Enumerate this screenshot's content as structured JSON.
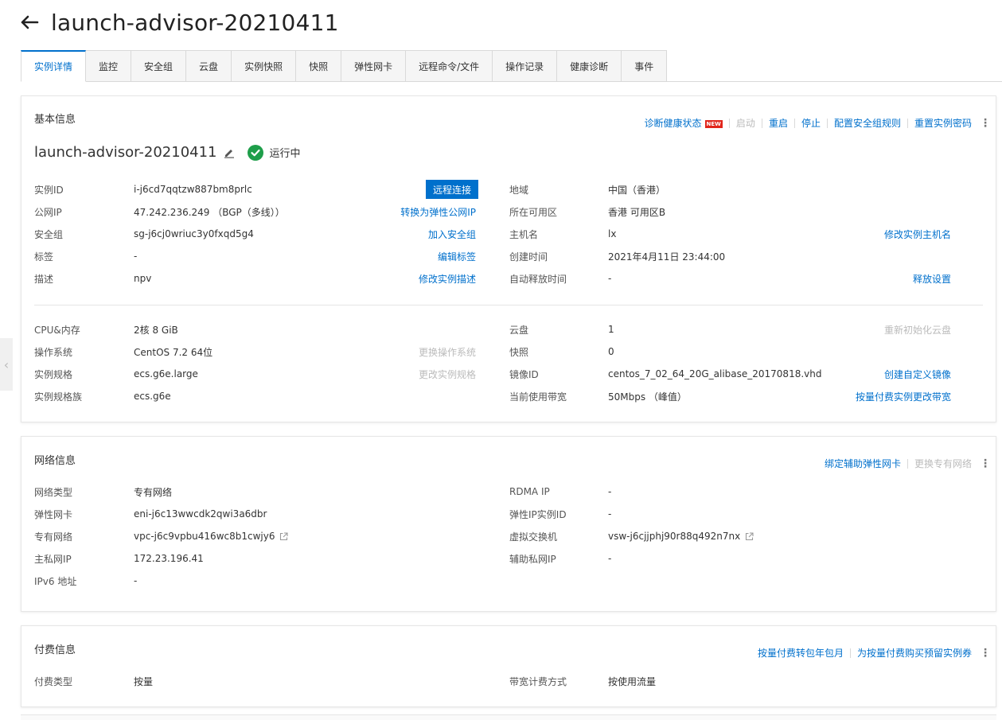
{
  "page": {
    "title": "launch-advisor-20210411"
  },
  "tabs": [
    {
      "label": "实例详情"
    },
    {
      "label": "监控"
    },
    {
      "label": "安全组"
    },
    {
      "label": "云盘"
    },
    {
      "label": "实例快照"
    },
    {
      "label": "快照"
    },
    {
      "label": "弹性网卡"
    },
    {
      "label": "远程命令/文件"
    },
    {
      "label": "操作记录"
    },
    {
      "label": "健康诊断"
    },
    {
      "label": "事件"
    }
  ],
  "basic": {
    "title": "基本信息",
    "actions": {
      "diagnose": "诊断健康状态",
      "new_badge": "NEW",
      "start": "启动",
      "restart": "重启",
      "stop": "停止",
      "sg_rules": "配置安全组规则",
      "reset_pwd": "重置实例密码"
    },
    "instance_name": "launch-advisor-20210411",
    "status": "运行中",
    "remote_connect": "远程连接",
    "left": [
      {
        "label": "实例ID",
        "value": "i-j6cd7qqtzw887bm8prlc",
        "action": ""
      },
      {
        "label": "公网IP",
        "value": "47.242.236.249 （BGP（多线））",
        "action": "转换为弹性公网IP"
      },
      {
        "label": "安全组",
        "value": "sg-j6cj0wriuc3y0fxqd5g4",
        "action": "加入安全组"
      },
      {
        "label": "标签",
        "value": "-",
        "action": "编辑标签"
      },
      {
        "label": "描述",
        "value": "npv",
        "action": "修改实例描述"
      }
    ],
    "right": [
      {
        "label": "地域",
        "value": "中国（香港）",
        "action": ""
      },
      {
        "label": "所在可用区",
        "value": "香港 可用区B",
        "action": ""
      },
      {
        "label": "主机名",
        "value": "lx",
        "action": "修改实例主机名"
      },
      {
        "label": "创建时间",
        "value": "2021年4月11日 23:44:00",
        "action": ""
      },
      {
        "label": "自动释放时间",
        "value": "-",
        "action": "释放设置"
      }
    ],
    "left2": [
      {
        "label": "CPU&内存",
        "value": "2核 8 GiB",
        "action": ""
      },
      {
        "label": "操作系统",
        "value": "CentOS 7.2 64位",
        "action": "更换操作系统"
      },
      {
        "label": "实例规格",
        "value": "ecs.g6e.large",
        "action": "更改实例规格"
      },
      {
        "label": "实例规格族",
        "value": "ecs.g6e",
        "action": ""
      }
    ],
    "right2": [
      {
        "label": "云盘",
        "value": "1",
        "action": "重新初始化云盘"
      },
      {
        "label": "快照",
        "value": "0",
        "action": ""
      },
      {
        "label": "镜像ID",
        "value": "centos_7_02_64_20G_alibase_20170818.vhd",
        "action": "创建自定义镜像"
      },
      {
        "label": "当前使用带宽",
        "value": "50Mbps （峰值）",
        "action": "按量付费实例更改带宽"
      }
    ]
  },
  "network": {
    "title": "网络信息",
    "actions": {
      "bind_eni": "绑定辅助弹性网卡",
      "change_vpc": "更换专有网络"
    },
    "left": [
      {
        "label": "网络类型",
        "value": "专有网络"
      },
      {
        "label": "弹性网卡",
        "value": "eni-j6c13wwcdk2qwi3a6dbr"
      },
      {
        "label": "专有网络",
        "value": "vpc-j6c9vpbu416wc8b1cwjy6"
      },
      {
        "label": "主私网IP",
        "value": "172.23.196.41"
      },
      {
        "label": "IPv6 地址",
        "value": "-"
      }
    ],
    "right": [
      {
        "label": "RDMA IP",
        "value": "-"
      },
      {
        "label": "弹性IP实例ID",
        "value": "-"
      },
      {
        "label": "虚拟交换机",
        "value": "vsw-j6cjjphj90r88q492n7nx"
      },
      {
        "label": "辅助私网IP",
        "value": "-"
      }
    ]
  },
  "billing": {
    "title": "付费信息",
    "actions": {
      "to_subscription": "按量付费转包年包月",
      "buy_ri": "为按量付费购买预留实例券"
    },
    "left": {
      "label": "付费类型",
      "value": "按量"
    },
    "right": {
      "label": "带宽计费方式",
      "value": "按使用流量"
    }
  },
  "colors": {
    "primary": "#0070cc",
    "success": "#1e9e4a",
    "badge": "#e1251b",
    "disabled": "#bbbbbb"
  }
}
